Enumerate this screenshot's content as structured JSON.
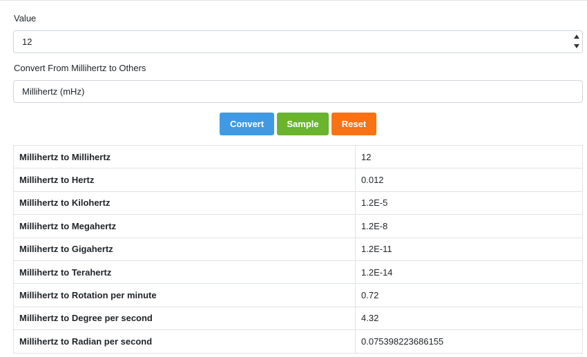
{
  "value_label": "Value",
  "value_input": "12",
  "from_label": "Convert From Millihertz to Others",
  "from_select": "Millihertz (mHz)",
  "buttons": {
    "convert": "Convert",
    "sample": "Sample",
    "reset": "Reset"
  },
  "colors": {
    "convert": "#3f9ae3",
    "sample": "#6ab42e",
    "reset": "#fa7213"
  },
  "results": [
    {
      "unit": "Millihertz to Millihertz",
      "value": "12"
    },
    {
      "unit": "Millihertz to Hertz",
      "value": "0.012"
    },
    {
      "unit": "Millihertz to Kilohertz",
      "value": "1.2E-5"
    },
    {
      "unit": "Millihertz to Megahertz",
      "value": "1.2E-8"
    },
    {
      "unit": "Millihertz to Gigahertz",
      "value": "1.2E-11"
    },
    {
      "unit": "Millihertz to Terahertz",
      "value": "1.2E-14"
    },
    {
      "unit": "Millihertz to Rotation per minute",
      "value": "0.72"
    },
    {
      "unit": "Millihertz to Degree per second",
      "value": "4.32"
    },
    {
      "unit": "Millihertz to Radian per second",
      "value": "0.075398223686155"
    }
  ]
}
